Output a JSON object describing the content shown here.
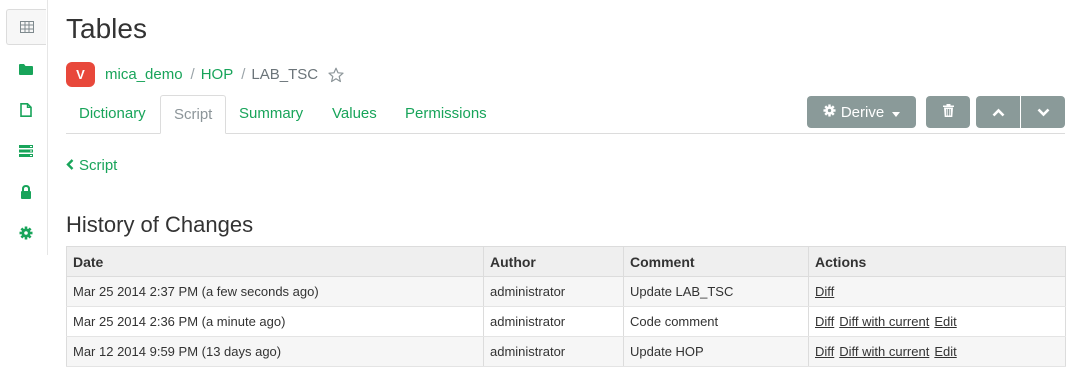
{
  "sidebar": {
    "items": [
      {
        "icon": "table-icon",
        "active": true
      },
      {
        "icon": "folder-icon"
      },
      {
        "icon": "file-icon"
      },
      {
        "icon": "server-icon"
      },
      {
        "icon": "lock-icon"
      },
      {
        "icon": "gear-icon"
      }
    ]
  },
  "header": {
    "title": "Tables",
    "badge": "V",
    "breadcrumb": {
      "project": "mica_demo",
      "table": "HOP",
      "current": "LAB_TSC"
    }
  },
  "tabs": [
    "Dictionary",
    "Script",
    "Summary",
    "Values",
    "Permissions"
  ],
  "active_tab": "Script",
  "toolbar": {
    "derive_label": "Derive"
  },
  "back_link": "Script",
  "history": {
    "title": "History of Changes",
    "columns": [
      "Date",
      "Author",
      "Comment",
      "Actions"
    ],
    "rows": [
      {
        "date": "Mar 25 2014 2:37 PM (a few seconds ago)",
        "author": "administrator",
        "comment": "Update LAB_TSC",
        "actions": [
          "Diff"
        ]
      },
      {
        "date": "Mar 25 2014 2:36 PM (a minute ago)",
        "author": "administrator",
        "comment": "Code comment",
        "actions": [
          "Diff",
          "Diff with current",
          "Edit"
        ]
      },
      {
        "date": "Mar 12 2014 9:59 PM (13 days ago)",
        "author": "administrator",
        "comment": "Update HOP",
        "actions": [
          "Diff",
          "Diff with current",
          "Edit"
        ]
      }
    ]
  },
  "colors": {
    "accent": "#18a45a",
    "button": "#8a9a99",
    "badge": "#e8483b"
  }
}
